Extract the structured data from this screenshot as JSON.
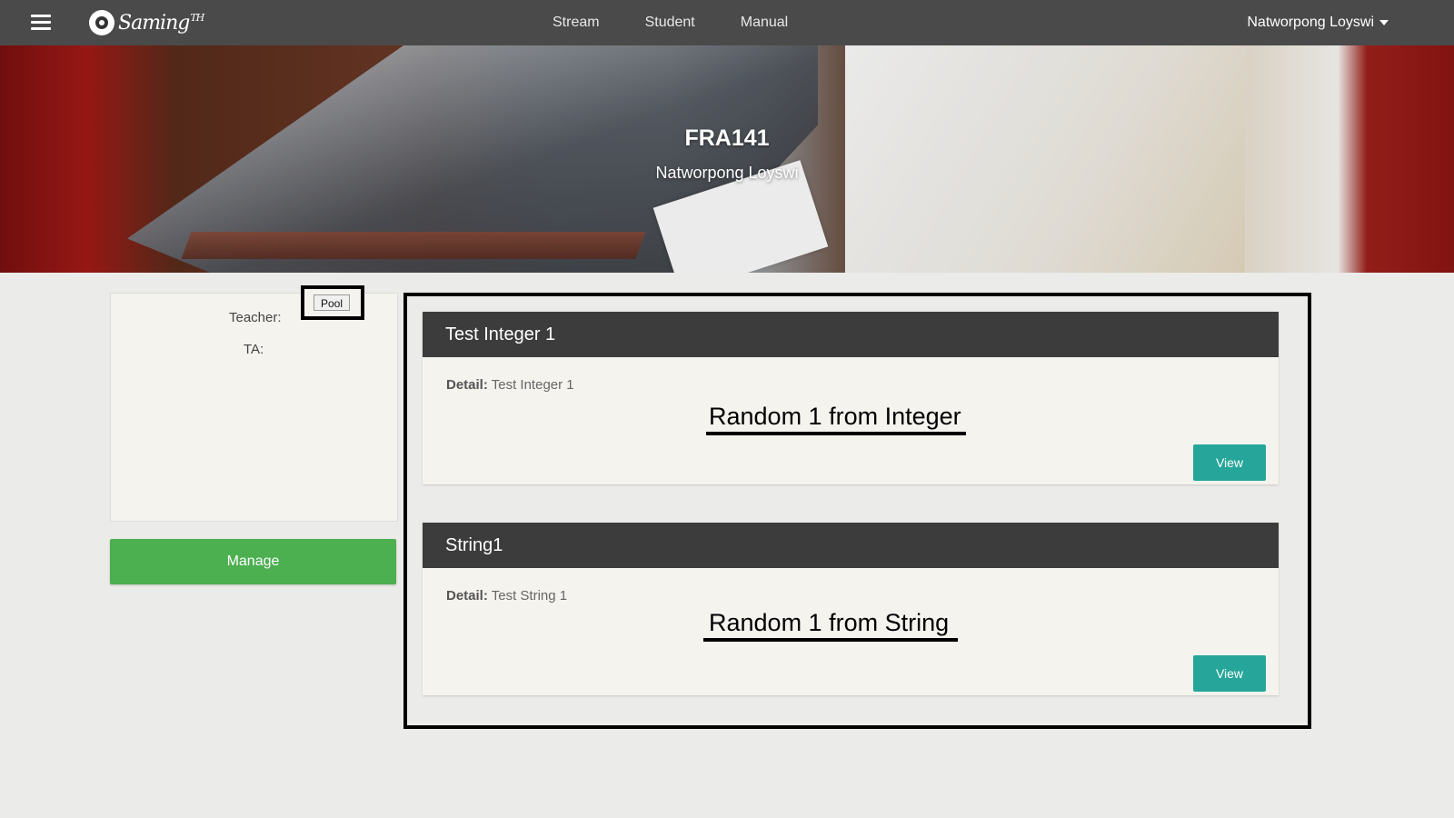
{
  "nav": {
    "brand": "Saming",
    "brand_suffix": "TH",
    "links": [
      "Stream",
      "Student",
      "Manual"
    ],
    "user": "Natworpong Loyswi"
  },
  "hero": {
    "title": "FRA141",
    "subtitle": "Natworpong Loyswi"
  },
  "info": {
    "teacher_label": "Teacher:",
    "ta_label": "TA:",
    "pool_button": "Pool",
    "manage_button": "Manage"
  },
  "questions": [
    {
      "title": "Test Integer 1",
      "detail_label": "Detail:",
      "detail": "Test Integer 1",
      "random": "Random 1 from Integer",
      "view": "View"
    },
    {
      "title": "String1",
      "detail_label": "Detail:",
      "detail": "Test String 1",
      "random": "Random 1 from String",
      "view": "View"
    }
  ],
  "colors": {
    "navbar": "#4a4a4a",
    "manage": "#4caf50",
    "view": "#26a69a",
    "card_header": "#3c3c3c"
  }
}
